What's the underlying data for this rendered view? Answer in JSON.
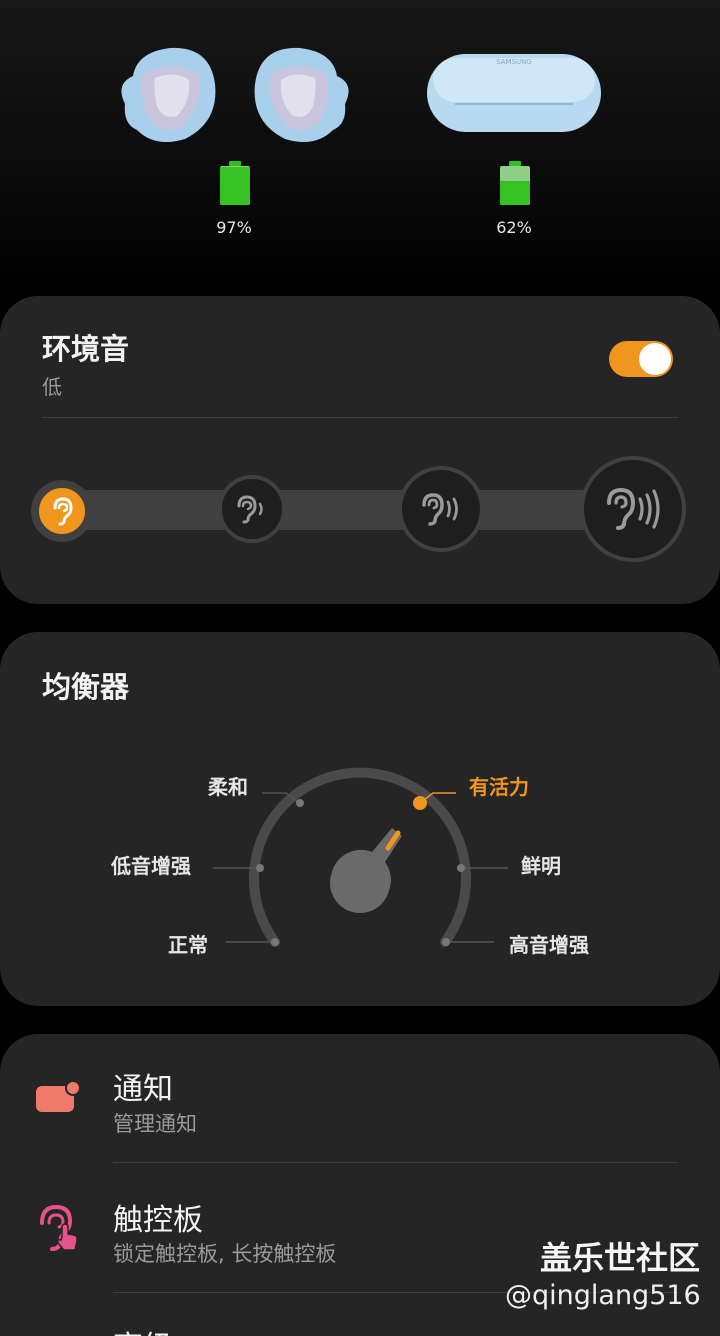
{
  "earbuds": {
    "buds_battery": {
      "label": "97%",
      "level": 0.97
    },
    "case_battery": {
      "label": "62%",
      "level": 0.62
    },
    "case_brand": "SAMSUNG"
  },
  "ambient": {
    "title": "环境音",
    "level_label": "低",
    "enabled": true,
    "levels": [
      "level-1",
      "level-2",
      "level-3",
      "level-4"
    ],
    "selected_level": 1
  },
  "equalizer": {
    "title": "均衡器",
    "presets": [
      "正常",
      "低音增强",
      "柔和",
      "有活力",
      "鲜明",
      "高音增强"
    ],
    "selected": "有活力"
  },
  "menu": {
    "items": [
      {
        "title": "通知",
        "subtitle": "管理通知",
        "icon": "notification-icon"
      },
      {
        "title": "触控板",
        "subtitle": "锁定触控板, 长按触控板",
        "icon": "touchpad-icon"
      },
      {
        "title": "高级",
        "subtitle": "",
        "icon": "advanced-icon"
      }
    ]
  },
  "watermark": {
    "site": "盖乐世社区",
    "user": "@qinglang516"
  },
  "colors": {
    "accent": "#f0961e",
    "card": "#252525",
    "battery": "#36c222",
    "notify": "#f07a6a",
    "touch": "#e8528a"
  }
}
